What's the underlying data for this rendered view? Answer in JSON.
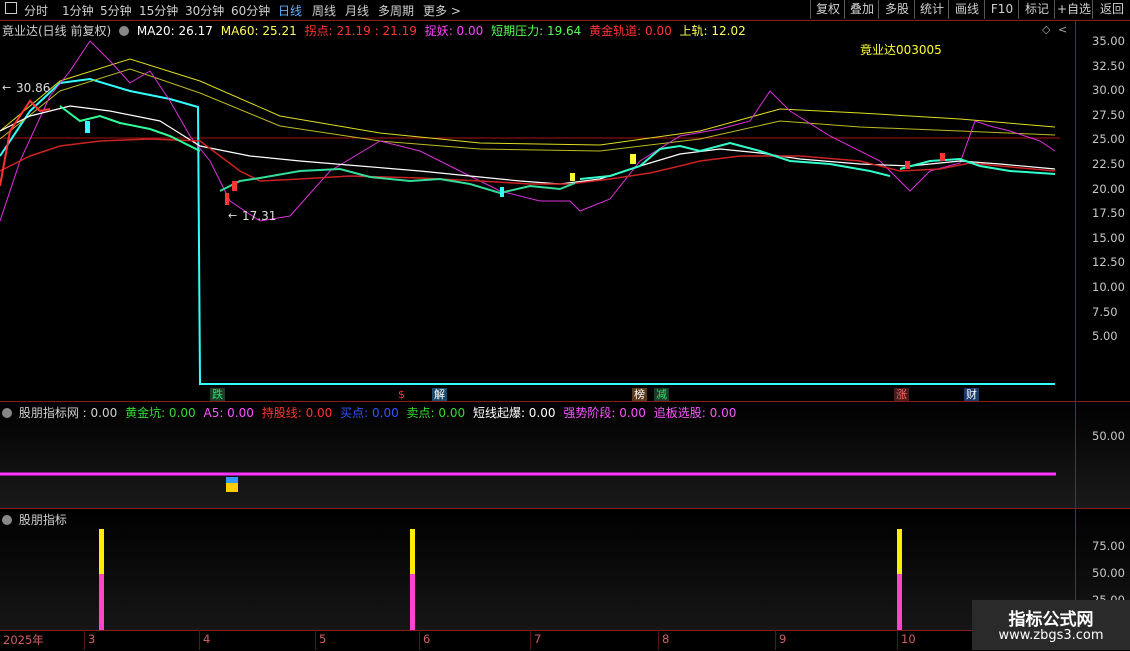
{
  "toolbar": {
    "periods": [
      "分时",
      "1分钟",
      "5分钟",
      "15分钟",
      "30分钟",
      "60分钟",
      "日线",
      "周线",
      "月线",
      "多周期",
      "更多 >"
    ],
    "active": "日线",
    "buttons": [
      "复权",
      "叠加",
      "多股",
      "统计",
      "画线",
      "F10",
      "标记",
      "+自选",
      "返回"
    ]
  },
  "main": {
    "title": "竟业达(日线 前复权)",
    "ma20_label": "MA20: 26.17",
    "ma60_label": "MA60: 25.21",
    "guaidian_label": "拐点: 21.19",
    "guaidian_value": ": 21.19",
    "zhuoyao_label": "捉妖: 0.00",
    "duanqi_label": "短期压力: 19.64",
    "huangjin_label": "黄金轨道: 0.00",
    "shanggui_label": "上轨: 12.02",
    "stock_label": "竟业达003005",
    "high_label": "30.86",
    "low_label": "17.31",
    "yticks": [
      "35.00",
      "32.50",
      "30.00",
      "27.50",
      "25.00",
      "22.50",
      "20.00",
      "17.50",
      "15.00",
      "12.50",
      "10.00",
      "7.50",
      "5.00"
    ],
    "markers": [
      {
        "text": "跌",
        "color": "#33dd66",
        "bg": "#1b3a2a"
      },
      {
        "text": "$",
        "color": "#ff3333",
        "bg": "transparent"
      },
      {
        "text": "解",
        "color": "#ffffff",
        "bg": "#1b4a6a"
      },
      {
        "text": "榜",
        "color": "#ffffff",
        "bg": "#5a3a1a"
      },
      {
        "text": "减",
        "color": "#33dd66",
        "bg": "#1b3a2a"
      },
      {
        "text": "涨",
        "color": "#ff6666",
        "bg": "#4a1a1a"
      },
      {
        "text": "财",
        "color": "#ffffff",
        "bg": "#1b3a6a"
      }
    ]
  },
  "pane2": {
    "title": "股朋指标网",
    "value": ": 0.00",
    "items": [
      {
        "text": "黄金坑: 0.00",
        "color": "#33dd33"
      },
      {
        "text": "A5: 0.00",
        "color": "#ff55ff"
      },
      {
        "text": "持股线: 0.00",
        "color": "#ff3333"
      },
      {
        "text": "买点: 0.00",
        "color": "#3355ff"
      },
      {
        "text": "卖点: 0.00",
        "color": "#33dd33"
      },
      {
        "text": "短线起爆: 0.00",
        "color": "#ffffff"
      },
      {
        "text": "强势阶段: 0.00",
        "color": "#ff55ff"
      },
      {
        "text": "追板选股: 0.00",
        "color": "#ff55ff"
      }
    ],
    "ytick": "50.00"
  },
  "pane3": {
    "title": "股朋指标",
    "yticks": [
      "75.00",
      "50.00",
      "25.00"
    ]
  },
  "xaxis": {
    "labels": [
      "2025年",
      "3",
      "4",
      "5",
      "6",
      "7",
      "8",
      "9",
      "10"
    ]
  },
  "watermark": {
    "line1": "指标公式网",
    "line2": "www.zbgs3.com"
  },
  "colors": {
    "up": "#ff3333",
    "down": "#33ffff",
    "grid": "#8a1c1c",
    "ma_white": "#ffffff",
    "ma_yellow": "#ffff00",
    "cyan_line": "#33ffff",
    "magenta": "#ff33ff"
  }
}
